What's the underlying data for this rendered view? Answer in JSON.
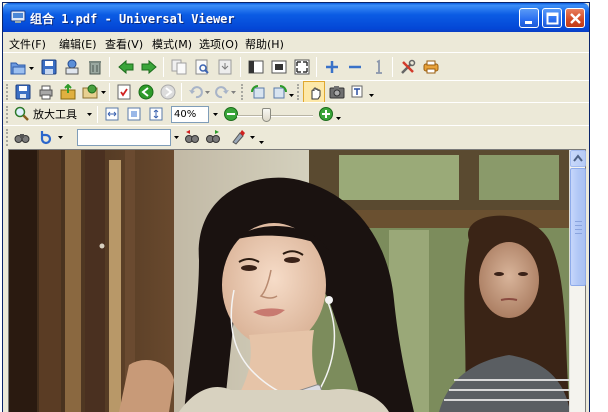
{
  "window": {
    "title": "组合 1.pdf - Universal Viewer"
  },
  "menu": {
    "items": [
      {
        "label": "文件(F)"
      },
      {
        "label": "编辑(E)"
      },
      {
        "label": "查看(V)"
      },
      {
        "label": "模式(M)"
      },
      {
        "label": "选项(O)"
      },
      {
        "label": "帮助(H)"
      }
    ]
  },
  "toolbar3": {
    "zoom_tool_label": "放大工具",
    "zoom_value": "40%",
    "zoom_slider_fraction": 0.4
  },
  "toolbar4": {
    "search_value": ""
  },
  "colors": {
    "titlebar": "#0b5ce4",
    "chrome": "#ece9d8",
    "accent_green": "#2e9b2a",
    "accent_blue": "#2a66cc"
  }
}
